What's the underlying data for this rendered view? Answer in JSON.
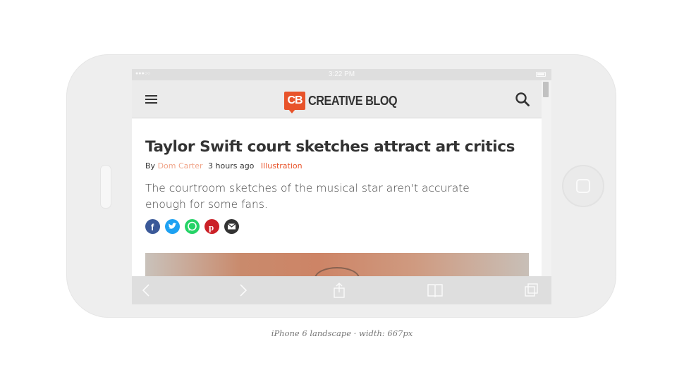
{
  "status_bar": {
    "signal": "●●●○○",
    "time": "3:22 PM"
  },
  "header": {
    "logo_mark": "CB",
    "logo_text": "CREATIVE BLOQ",
    "menu_icon": "hamburger-menu-icon",
    "search_icon": "search-icon"
  },
  "article": {
    "title": "Taylor Swift court sketches attract art critics",
    "by_label": "By",
    "author": "Dom Carter",
    "time_ago": "3 hours ago",
    "category": "Illustration",
    "summary": "The courtroom sketches of the musical star aren't accurate enough for some fans.",
    "share_icons": [
      "facebook-icon",
      "twitter-icon",
      "whatsapp-icon",
      "pinterest-icon",
      "email-icon"
    ]
  },
  "browser_toolbar": {
    "icons": [
      "back-icon",
      "forward-icon",
      "share-icon",
      "bookmarks-icon",
      "tabs-icon"
    ]
  },
  "caption": "iPhone 6 landscape · width: 667px",
  "colors": {
    "brand": "#e8532a",
    "facebook": "#3b5998",
    "twitter": "#1da1f2",
    "whatsapp": "#25d366",
    "pinterest": "#cb2027",
    "email": "#333333"
  }
}
